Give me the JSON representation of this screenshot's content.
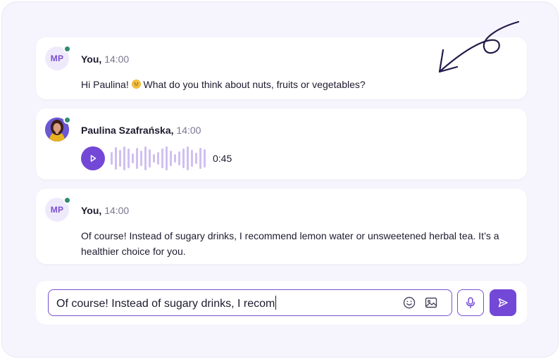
{
  "messages": [
    {
      "avatar_initials": "MP",
      "author": "You,",
      "time": "14:00",
      "text": "Hi Paulina!",
      "text_after_emoji": "What do you think about nuts, fruits or vegetables?",
      "emoji": "smiling-face-emoji"
    },
    {
      "author": "Paulina Szafrańska,",
      "time": "14:00",
      "type": "voice",
      "duration": "0:45",
      "icon": "play-icon"
    },
    {
      "avatar_initials": "MP",
      "author": "You,",
      "time": "14:00",
      "text": "Of course! Instead of sugary drinks, I recommend lemon water or unsweetened herbal tea. It’s a healthier choice for you."
    }
  ],
  "composer": {
    "value": "Of course! Instead of sugary drinks, I recom",
    "icons": [
      "smile-icon",
      "image-icon",
      "microphone-icon",
      "send-icon"
    ]
  },
  "colors": {
    "accent": "#7348d6",
    "online": "#2f8a6e",
    "background": "#f6f4fc",
    "wave": "#cfc0f0"
  },
  "decorations": [
    "hand-drawn-arrow"
  ]
}
